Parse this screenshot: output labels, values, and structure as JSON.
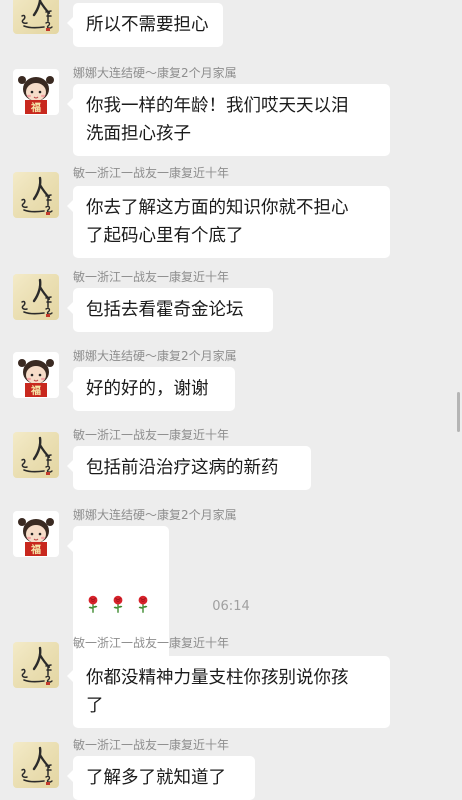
{
  "messages": [
    {
      "sender": "",
      "text": "所以不需要担心",
      "avatar": "calligraphy-avatar"
    },
    {
      "sender": "娜娜大连结硬～康复2个月家属",
      "text": "你我一样的年龄！我们哎天天以泪\n洗面担心孩子",
      "avatar": "girl-avatar"
    },
    {
      "sender": "敏一浙江一战友一康复近十年",
      "text": "你去了解这方面的知识你就不担心\n了起码心里有个底了",
      "avatar": "calligraphy-avatar"
    },
    {
      "sender": "敏一浙江一战友一康复近十年",
      "text": "包括去看霍奇金论坛",
      "avatar": "calligraphy-avatar"
    },
    {
      "sender": "娜娜大连结硬～康复2个月家属",
      "text": "好的好的，谢谢",
      "avatar": "girl-avatar"
    },
    {
      "sender": "敏一浙江一战友一康复近十年",
      "text": "包括前沿治疗这病的新药",
      "avatar": "calligraphy-avatar"
    },
    {
      "sender": "娜娜大连结硬～康复2个月家属",
      "text": "",
      "emoji": [
        "rose",
        "rose",
        "rose"
      ],
      "avatar": "girl-avatar"
    },
    {
      "sender": "敏一浙江一战友一康复近十年",
      "text": "你都没精神力量支柱你孩别说你孩\n了",
      "avatar": "calligraphy-avatar"
    },
    {
      "sender": "敏一浙江一战友一康复近十年",
      "text": "了解多了就知道了",
      "avatar": "calligraphy-avatar"
    }
  ],
  "timestamp": "06:14",
  "calligraphy_avatar_text": "人生路",
  "girl_avatar_sign_text": "福",
  "colors": {
    "background": "#ededed",
    "bubble": "#ffffff",
    "text": "#1a1a1a",
    "sender": "#8e8e8e",
    "sign_red": "#c8281e"
  }
}
